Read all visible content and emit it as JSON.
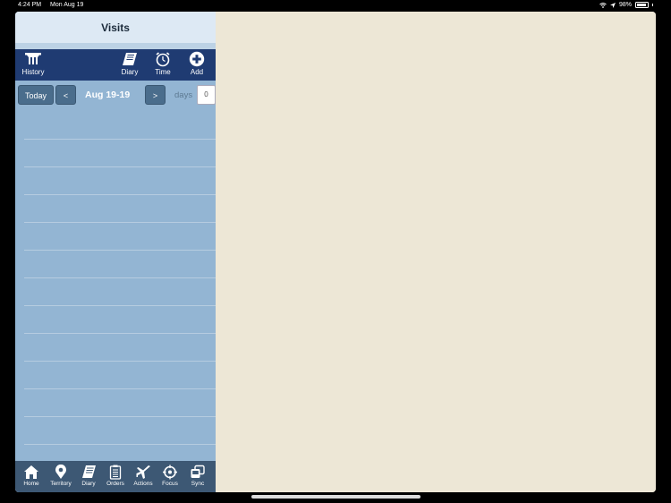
{
  "status": {
    "time": "4:24 PM",
    "date": "Mon Aug 19",
    "battery": "98%"
  },
  "nav": {
    "title": "Visits"
  },
  "toolbar": {
    "history": "History",
    "diary": "Diary",
    "time": "Time",
    "add": "Add"
  },
  "datebar": {
    "today": "Today",
    "prev": "<",
    "range": "Aug 19-19",
    "next": ">",
    "days_label": "days",
    "days_value": "0"
  },
  "tabs": {
    "home": "Home",
    "territory": "Territory",
    "diary": "Diary",
    "orders": "Orders",
    "actions": "Actions",
    "focus": "Focus",
    "sync": "Sync"
  },
  "colors": {
    "toolbar": "#1f3b72",
    "panel": "#93b5d3",
    "detail": "#ede7d6",
    "tabbar": "#3d5874"
  }
}
